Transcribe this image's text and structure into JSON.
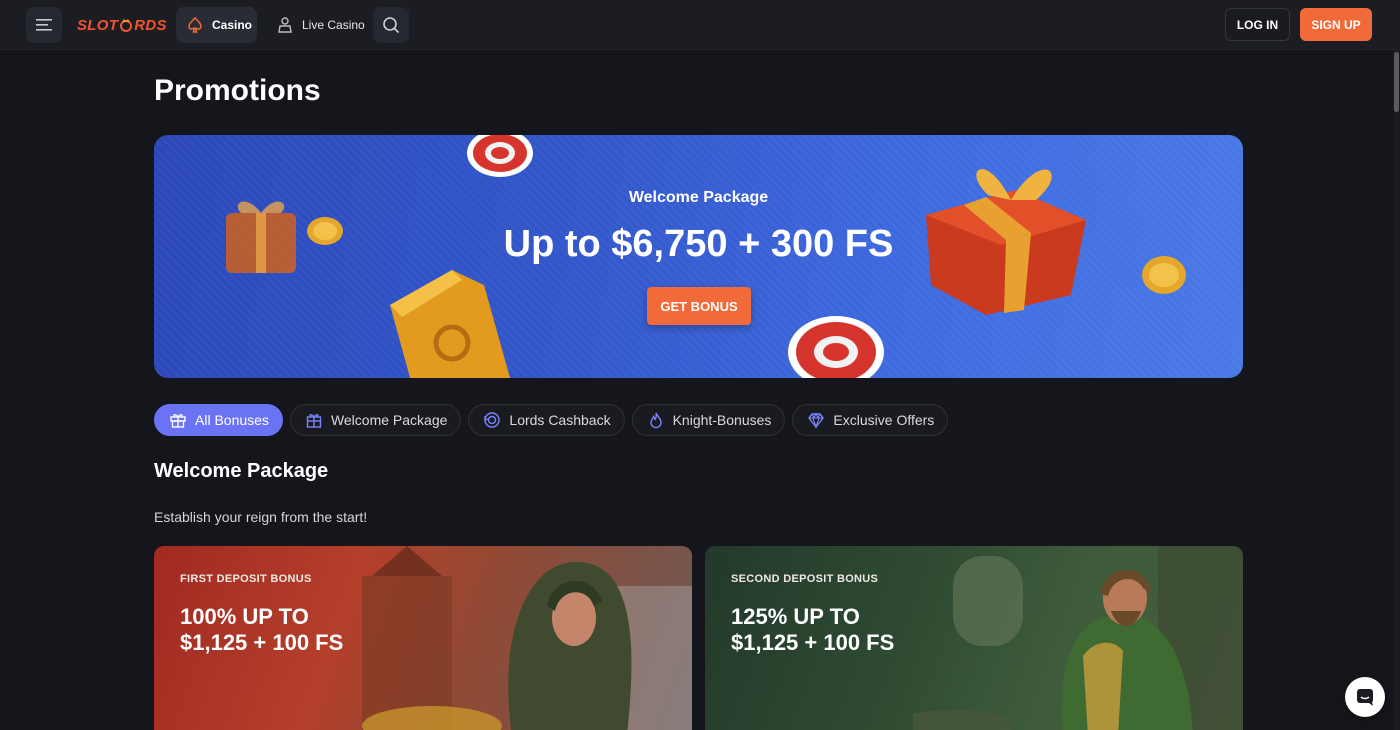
{
  "header": {
    "logo_text_left": "SLOT",
    "logo_text_right": "RDS",
    "nav_casino_label": "Casino",
    "nav_live_label": "Live Casino",
    "login_label": "LOG IN",
    "signup_label": "SIGN UP"
  },
  "page": {
    "title": "Promotions"
  },
  "hero": {
    "subtitle": "Welcome Package",
    "title": "Up to $6,750 + 300 FS",
    "button_label": "GET BONUS"
  },
  "tabs": [
    {
      "label": "All Bonuses",
      "icon": "gift-icon",
      "active": true
    },
    {
      "label": "Welcome Package",
      "icon": "gift-box-icon",
      "active": false
    },
    {
      "label": "Lords Cashback",
      "icon": "cashback-icon",
      "active": false
    },
    {
      "label": "Knight-Bonuses",
      "icon": "flame-icon",
      "active": false
    },
    {
      "label": "Exclusive Offers",
      "icon": "diamond-icon",
      "active": false
    }
  ],
  "section": {
    "title": "Welcome Package",
    "description": "Establish your reign from the start!"
  },
  "cards": [
    {
      "label": "FIRST DEPOSIT BONUS",
      "title_line1": "100% UP TO",
      "title_line2": "$1,125 + 100 FS"
    },
    {
      "label": "SECOND DEPOSIT BONUS",
      "title_line1": "125% UP TO",
      "title_line2": "$1,125 + 100 FS"
    }
  ],
  "colors": {
    "accent_orange": "#f06a3a",
    "accent_purple": "#6b73f5",
    "background": "#15161b",
    "hero_blue": "#3358cb"
  }
}
